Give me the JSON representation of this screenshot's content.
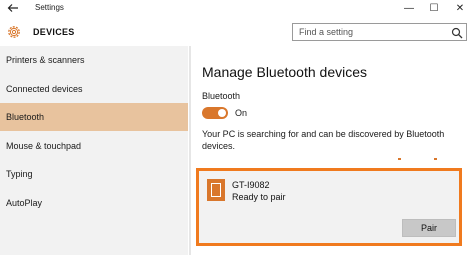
{
  "window": {
    "title": "Settings",
    "back_icon": "back-arrow-icon",
    "minimize_glyph": "—",
    "maximize_glyph": "☐",
    "close_glyph": "✕"
  },
  "header": {
    "title": "DEVICES",
    "icon": "gear-icon"
  },
  "search": {
    "placeholder": "Find a setting",
    "icon": "search-icon"
  },
  "sidebar": {
    "items": [
      {
        "label": "Printers & scanners",
        "active": false
      },
      {
        "label": "Connected devices",
        "active": false
      },
      {
        "label": "Bluetooth",
        "active": true
      },
      {
        "label": "Mouse & touchpad",
        "active": false
      },
      {
        "label": "Typing",
        "active": false
      },
      {
        "label": "AutoPlay",
        "active": false
      }
    ]
  },
  "main": {
    "heading": "Manage Bluetooth devices",
    "bluetooth_label": "Bluetooth",
    "toggle_state": "On",
    "discover_text": "Your PC is searching for and can be discovered by Bluetooth devices.",
    "device": {
      "name": "GT-I9082",
      "status": "Ready to pair",
      "pair_label": "Pair",
      "icon": "phone-icon"
    }
  },
  "colors": {
    "accent": "#d9772c",
    "highlight_border": "#f07a1e",
    "sidebar_active": "#e8c39e",
    "sidebar_bg": "#f2f2f2"
  }
}
